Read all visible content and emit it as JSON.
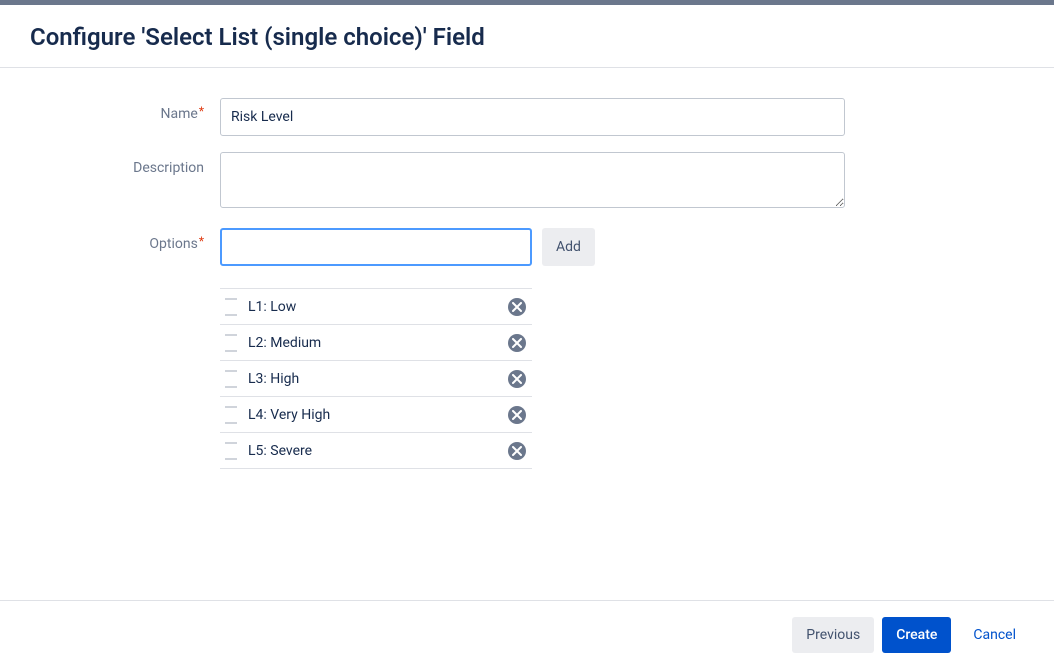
{
  "header": {
    "title": "Configure 'Select List (single choice)' Field"
  },
  "form": {
    "name_label": "Name",
    "name_value": "Risk Level",
    "description_label": "Description",
    "description_value": "",
    "options_label": "Options",
    "option_input_value": "",
    "add_label": "Add",
    "options": [
      {
        "label": "L1: Low"
      },
      {
        "label": "L2: Medium"
      },
      {
        "label": "L3: High"
      },
      {
        "label": "L4: Very High"
      },
      {
        "label": "L5: Severe"
      }
    ]
  },
  "footer": {
    "previous_label": "Previous",
    "create_label": "Create",
    "cancel_label": "Cancel"
  }
}
